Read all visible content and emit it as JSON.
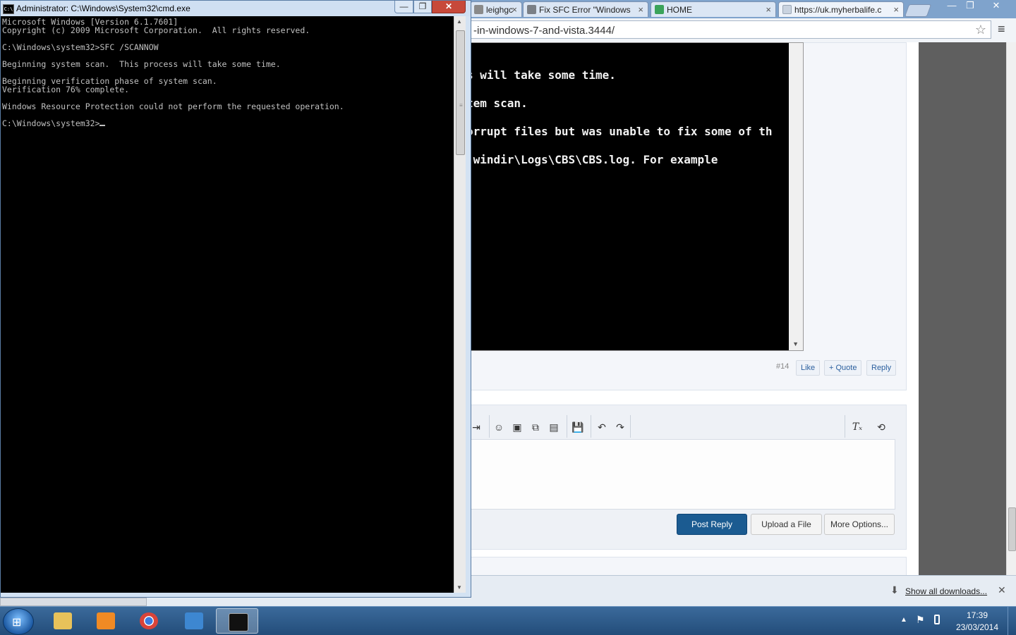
{
  "browser": {
    "tabs": [
      {
        "label": "leighgc",
        "favicon_color": "#8a8a8a"
      },
      {
        "label": "Fix SFC Error \"Windows I",
        "favicon_color": "#7a7f86"
      },
      {
        "label": "HOME",
        "favicon_color": "#3aa35a"
      },
      {
        "label": "https://uk.myherbalife.c",
        "favicon_color": "#c9d3e0"
      }
    ],
    "tab_close_glyph": "×",
    "url": "-in-windows-7-and-vista.3444/",
    "star_glyph": "☆",
    "menu_glyph": "≡",
    "window_controls": {
      "min": "—",
      "max": "❐",
      "close": "✕"
    }
  },
  "embedded_screenshot": {
    "lines": [
      "s will take some time.",
      "tem scan.",
      "orrupt files but was unable to fix some of th",
      " windir\\Logs\\CBS\\CBS.log. For example"
    ],
    "scroll_arrow": "▼"
  },
  "post": {
    "id": "#14",
    "like": "Like",
    "quote": "+ Quote",
    "reply": "Reply"
  },
  "editor": {
    "tools": [
      "⇥",
      "☺",
      "▣",
      "⧉",
      "▤",
      "💾",
      "↶",
      "↷"
    ],
    "clear_format": "Tₓ",
    "source": "⟲",
    "post_reply": "Post Reply",
    "upload": "Upload a File",
    "more": "More Options..."
  },
  "downloads": {
    "icon": "⬇",
    "show_all": "Show all downloads...",
    "close": "✕"
  },
  "cmd": {
    "title": "Administrator: C:\\Windows\\System32\\cmd.exe",
    "icon_text": "C:\\",
    "controls": {
      "min": "—",
      "max": "❐",
      "close": "✕"
    },
    "lines": [
      "Microsoft Windows [Version 6.1.7601]",
      "Copyright (c) 2009 Microsoft Corporation.  All rights reserved.",
      "",
      "C:\\Windows\\system32>SFC /SCANNOW",
      "",
      "Beginning system scan.  This process will take some time.",
      "",
      "Beginning verification phase of system scan.",
      "Verification 76% complete.",
      "",
      "Windows Resource Protection could not perform the requested operation.",
      "",
      "C:\\Windows\\system32>"
    ],
    "scroll_up": "▲",
    "scroll_down": "▼"
  },
  "taskbar": {
    "start_glyph": "⊞",
    "apps": [
      {
        "name": "explorer",
        "color": "#e8c25a",
        "active": false
      },
      {
        "name": "media-player",
        "color": "#f08a24",
        "active": false
      },
      {
        "name": "chrome",
        "color": "#d9443a",
        "active": false
      },
      {
        "name": "network-app",
        "color": "#3d87d1",
        "active": false
      },
      {
        "name": "cmd",
        "color": "#111111",
        "active": true
      }
    ],
    "tray_up": "▲",
    "flag": "⚑",
    "time": "17:39",
    "date": "23/03/2014"
  }
}
